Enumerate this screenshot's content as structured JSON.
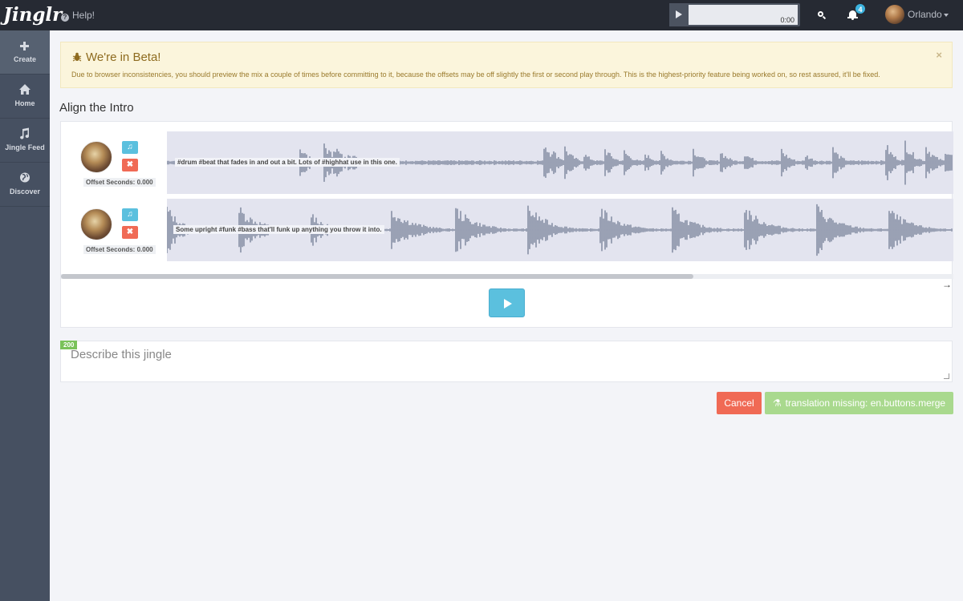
{
  "app": {
    "logo_text": "Jinglr"
  },
  "topbar": {
    "help_label": "Help!",
    "player_time": "0:00",
    "notification_count": "4",
    "user_name": "Orlando"
  },
  "sidebar": {
    "items": [
      {
        "label": "Create",
        "icon": "plus-icon"
      },
      {
        "label": "Home",
        "icon": "home-icon"
      },
      {
        "label": "Jingle Feed",
        "icon": "music-note-icon"
      },
      {
        "label": "Discover",
        "icon": "globe-icon"
      }
    ]
  },
  "alert": {
    "title": "We're in Beta!",
    "message": "Due to browser inconsistencies, you should preview the mix a couple of times before committing to it, because the offsets may be off slightly the first or second play through. This is the highest-priority feature being worked on, so rest assured, it'll be fixed.",
    "close": "×"
  },
  "section": {
    "title": "Align the Intro"
  },
  "tracks": [
    {
      "offset": "Offset Seconds: 0.000",
      "label": "#drum #beat that fades in and out a bit. Lots of #highhat use in this one.",
      "music_icon": "♫",
      "delete_icon": "✖"
    },
    {
      "offset": "Offset Seconds: 0.000",
      "label": "Some upright #funk #bass that'll funk up anything you throw it into.",
      "music_icon": "♫",
      "delete_icon": "✖"
    }
  ],
  "scroll_arrow": "→",
  "description": {
    "placeholder": "Describe this jingle",
    "char_count": "200"
  },
  "buttons": {
    "cancel": "Cancel",
    "merge": "translation missing: en.buttons.merge"
  },
  "colors": {
    "wave": "#7a849b",
    "accent": "#5bc0de",
    "danger": "#f06a55",
    "success": "#a9d98e"
  }
}
